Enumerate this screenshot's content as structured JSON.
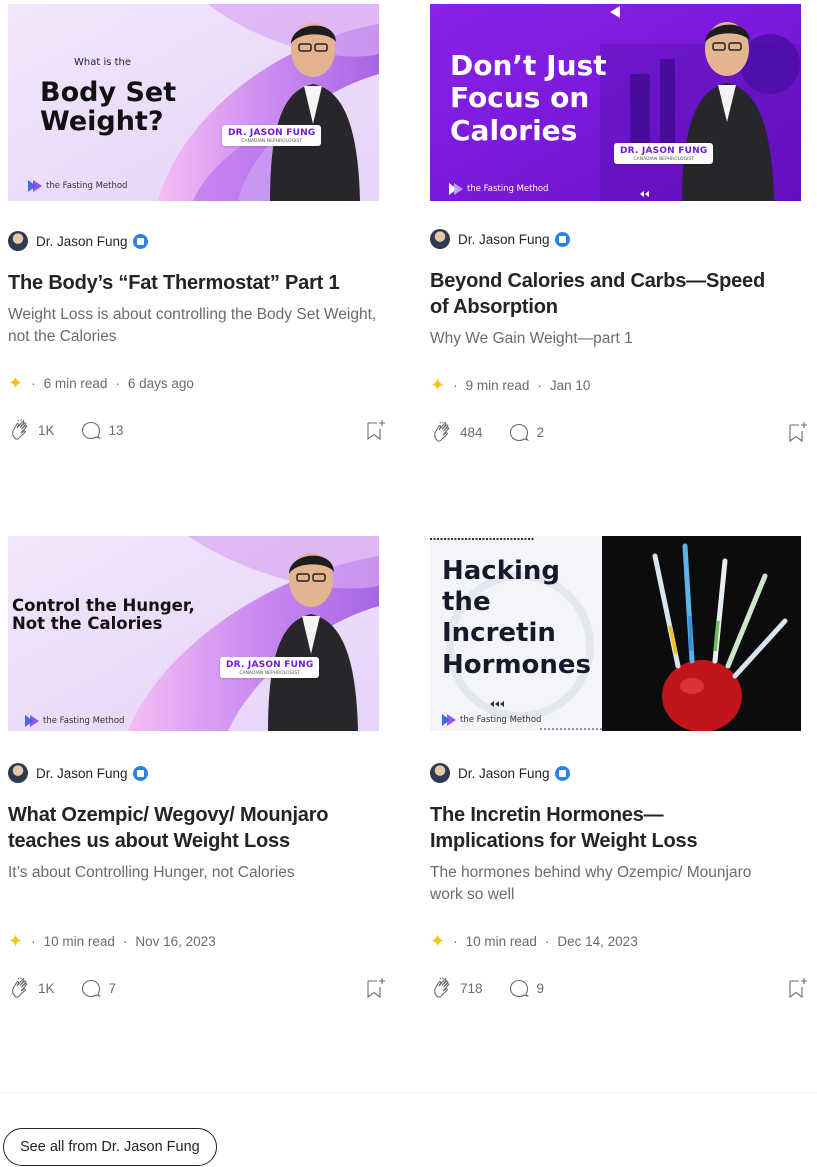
{
  "colors": {
    "accent_star": "#ffc017",
    "verified": "#2f80ed",
    "text": "#242424",
    "muted": "#6b6b6b"
  },
  "cards": [
    {
      "thumb": {
        "small": "What is the",
        "headline": [
          "Body Set",
          "Weight?"
        ],
        "tag_name": "DR. JASON FUNG",
        "tag_role": "CANADIAN NEPHROLOGIST",
        "logo": "the Fasting Method"
      },
      "author": "Dr. Jason Fung",
      "title": "The Body’s “Fat Thermostat” Part 1",
      "subtitle": "Weight Loss is about controlling the Body Set Weight, not the Calories",
      "read_time": "6 min read",
      "date": "6 days ago",
      "claps": "1K",
      "responses": "13"
    },
    {
      "thumb": {
        "headline": [
          "Don’t Just",
          "Focus on",
          "Calories"
        ],
        "tag_name": "DR. JASON FUNG",
        "tag_role": "CANADIAN NEPHROLOGIST",
        "logo": "the Fasting Method"
      },
      "author": "Dr. Jason Fung",
      "title": "Beyond Calories and Carbs—Speed of Absorption",
      "subtitle": "Why We Gain Weight—part 1",
      "read_time": "9 min read",
      "date": "Jan 10",
      "claps": "484",
      "responses": "2"
    },
    {
      "thumb": {
        "headline": [
          "Control the Hunger,",
          "Not the Calories"
        ],
        "tag_name": "DR. JASON FUNG",
        "tag_role": "CANADIAN NEPHROLOGIST",
        "logo": "the Fasting Method"
      },
      "author": "Dr. Jason Fung",
      "title": "What Ozempic/ Wegovy/ Mounjaro teaches us about Weight Loss",
      "subtitle": "It’s about Controlling Hunger, not Calories",
      "read_time": "10 min read",
      "date": "Nov 16, 2023",
      "claps": "1K",
      "responses": "7"
    },
    {
      "thumb": {
        "headline": [
          "Hacking",
          "the",
          "Incretin",
          "Hormones"
        ],
        "logo": "the Fasting Method"
      },
      "author": "Dr. Jason Fung",
      "title": "The Incretin Hormones—Implications for Weight Loss",
      "subtitle": "The hormones behind why Ozempic/ Mounjaro work so well",
      "read_time": "10 min read",
      "date": "Dec 14, 2023",
      "claps": "718",
      "responses": "9"
    }
  ],
  "footer": {
    "see_all": "See all from Dr. Jason Fung"
  },
  "icons": [
    "star-icon",
    "clap-icon",
    "response-icon",
    "bookmark-add-icon",
    "verified-badge-icon"
  ]
}
